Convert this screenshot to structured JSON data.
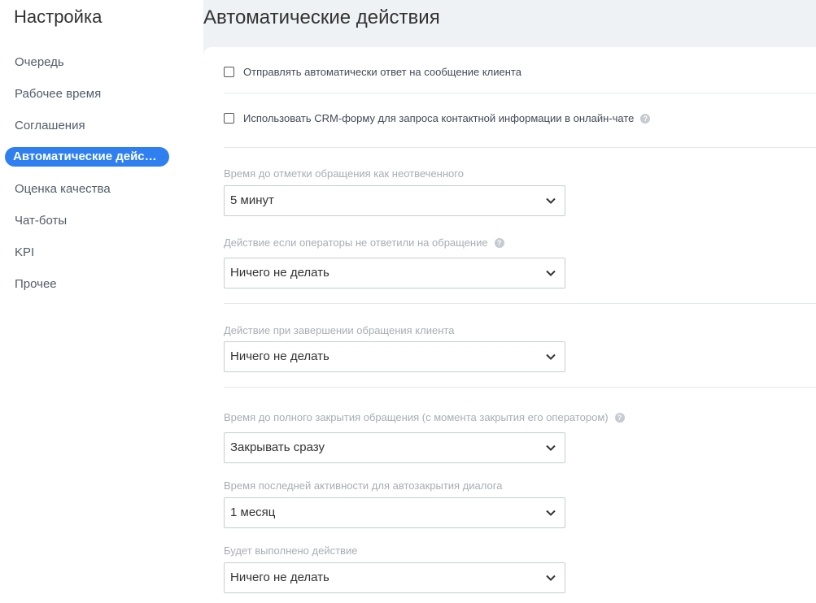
{
  "sidebar": {
    "title": "Настройка",
    "items": [
      {
        "label": "Очередь"
      },
      {
        "label": "Рабочее время"
      },
      {
        "label": "Соглашения"
      },
      {
        "label": "Автоматические действия"
      },
      {
        "label": "Оценка качества"
      },
      {
        "label": "Чат-боты"
      },
      {
        "label": "KPI"
      },
      {
        "label": "Прочее"
      }
    ],
    "active_index": 3
  },
  "page": {
    "title": "Автоматические действия"
  },
  "options": {
    "auto_reply": {
      "label": "Отправлять автоматически ответ на сообщение клиента",
      "checked": false
    },
    "crm_form": {
      "label": "Использовать CRM-форму для запроса контактной информации в онлайн-чате",
      "checked": false
    }
  },
  "fields": {
    "unanswered_time": {
      "label": "Время до отметки обращения как неотвеченного",
      "value": "5 минут"
    },
    "no_answer_action": {
      "label": "Действие если операторы не ответили на обращение",
      "value": "Ничего не делать"
    },
    "finish_action": {
      "label": "Действие при завершении обращения клиента",
      "value": "Ничего не делать"
    },
    "full_close_time": {
      "label": "Время до полного закрытия обращения (с момента закрытия его оператором)",
      "value": "Закрывать сразу"
    },
    "last_activity": {
      "label": "Время последней активности для автозакрытия диалога",
      "value": "1 месяц"
    },
    "planned_action": {
      "label": "Будет выполнено действие",
      "value": "Ничего не делать"
    }
  },
  "colors": {
    "accent": "#2f7ff0",
    "background": "#eef2f4"
  }
}
